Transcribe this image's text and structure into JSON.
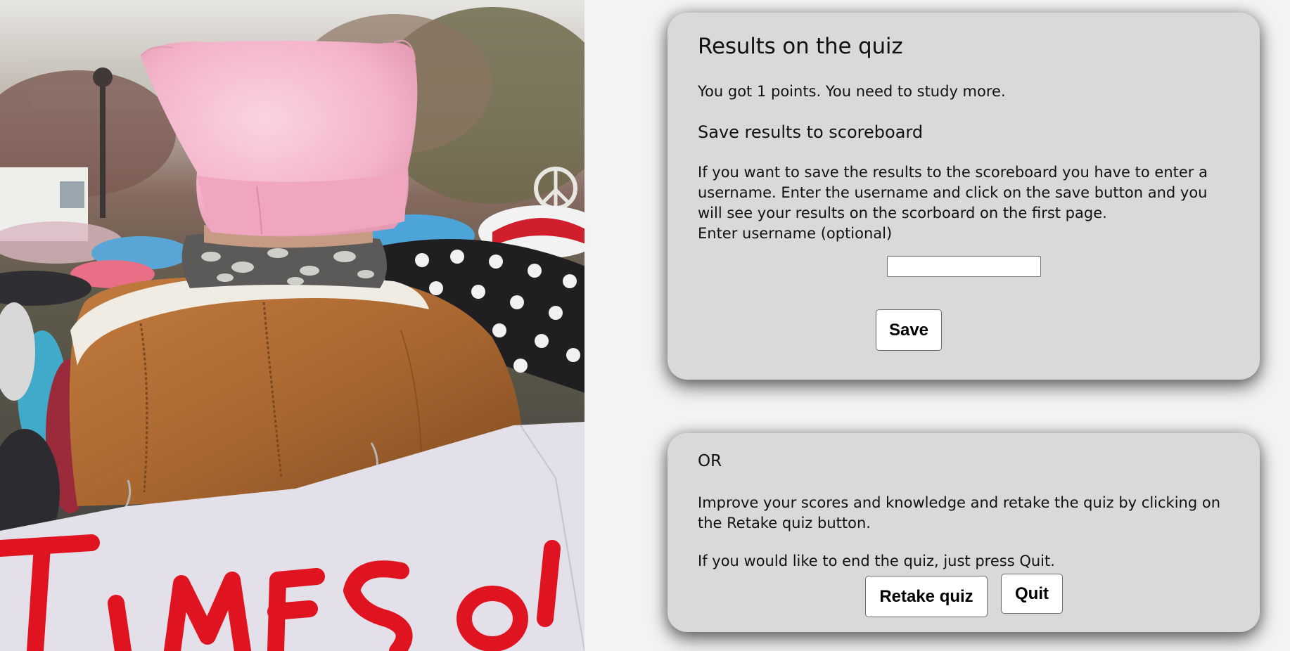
{
  "results_card": {
    "title": "Results on the quiz",
    "score_message": "You got 1 points. You need to study more.",
    "scoreboard_heading": "Save results to scoreboard",
    "scoreboard_instructions": "If you want to save the results to the scoreboard you have to enter a username. Enter the username and click on the save button and you will see your results on the scorboard on the first page.",
    "username_label": "Enter username (optional)",
    "username_value": "",
    "username_placeholder": "",
    "save_label": "Save"
  },
  "or_card": {
    "heading": "OR",
    "retake_text": "Improve your scores and knowledge and retake the quiz by clicking on the Retake quiz button.",
    "quit_text": "If you would like to end the quiz, just press Quit.",
    "retake_label": "Retake quiz",
    "quit_label": "Quit"
  },
  "photo": {
    "sign_text": "TIMES",
    "colors": {
      "hat": "#f5b8cc",
      "jacket": "#b06d35",
      "sign_board": "#e3e0ea",
      "sign_letters": "#e01420"
    }
  },
  "colors": {
    "page_background": "#f3f3f4",
    "card_background": "#d9d9d9",
    "button_background": "#ffffff"
  }
}
